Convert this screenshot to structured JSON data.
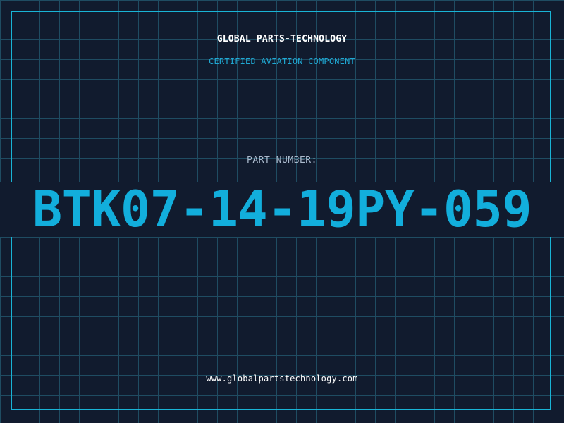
{
  "header": {
    "company_name": "GLOBAL PARTS-TECHNOLOGY",
    "tagline": "CERTIFIED AVIATION COMPONENT"
  },
  "part": {
    "label": "PART NUMBER:",
    "number": "BTK07-14-19PY-059"
  },
  "footer": {
    "website": "www.globalpartstechnology.com"
  },
  "colors": {
    "background": "#111b2e",
    "grid": "#1f4c62",
    "accent": "#19b4d6",
    "part_number": "#12aedc",
    "title": "#ffffff",
    "label": "#aab9cc"
  }
}
